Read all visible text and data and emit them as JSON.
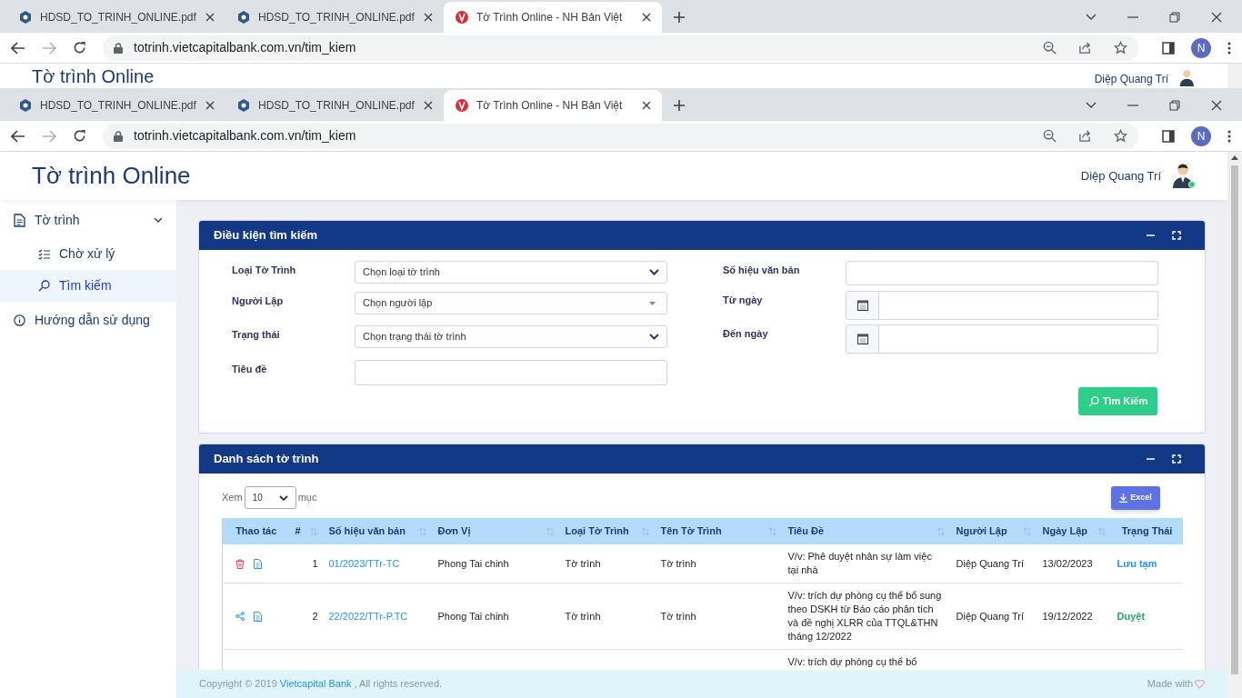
{
  "back_window": {
    "tabs": [
      {
        "kind": "pdf",
        "title": "HDSD_TO_TRINH_ONLINE.pdf",
        "selected": false
      },
      {
        "kind": "pdf",
        "title": "HDSD_TO_TRINH_ONLINE.pdf",
        "selected": false
      },
      {
        "kind": "site",
        "title": "Tờ Trình Online - NH Bản Việt",
        "selected": true
      }
    ],
    "url": "totrinh.vietcapitalbank.com.vn/tim_kiem",
    "profile_initial": "N",
    "page_title": "Tờ trình Online",
    "user_name": "Diệp Quang Trí"
  },
  "window": {
    "tabs": [
      {
        "kind": "pdf",
        "title": "HDSD_TO_TRINH_ONLINE.pdf",
        "selected": false
      },
      {
        "kind": "pdf",
        "title": "HDSD_TO_TRINH_ONLINE.pdf",
        "selected": false
      },
      {
        "kind": "site",
        "title": "Tờ Trình Online - NH Bản Việt",
        "selected": true
      }
    ],
    "url": "totrinh.vietcapitalbank.com.vn/tim_kiem",
    "profile_initial": "N"
  },
  "header": {
    "title": "Tờ trình Online",
    "user_name": "Diệp Quang Trí"
  },
  "sidebar": {
    "items": [
      {
        "label": "Tờ trình",
        "kind": "doc",
        "selected": false,
        "expanded": true,
        "children": [
          {
            "label": "Chờ xử lý",
            "kind": "list",
            "selected": false
          },
          {
            "label": "Tìm kiếm",
            "kind": "search",
            "selected": true
          }
        ]
      },
      {
        "label": "Hướng dẫn sử dụng",
        "kind": "info",
        "selected": false
      }
    ]
  },
  "search_form": {
    "title": "Điều kiện tìm kiếm",
    "left_fields": [
      {
        "label": "Loại Tờ Trình",
        "kind": "select",
        "value": "Chọn loại tờ trình"
      },
      {
        "label": "Người Lập",
        "kind": "combo",
        "value": "Chọn người lập"
      },
      {
        "label": "Trạng thái",
        "kind": "select",
        "value": "Chọn trạng thái tờ trình"
      },
      {
        "label": "Tiêu đề",
        "kind": "text"
      }
    ],
    "right_fields": [
      {
        "label": "Số hiệu văn bản",
        "kind": "text"
      },
      {
        "label": "Từ ngày",
        "kind": "date"
      },
      {
        "label": "Đến ngày",
        "kind": "date"
      }
    ],
    "button": "Tìm Kiếm"
  },
  "list": {
    "title": "Danh sách tờ trình",
    "show_label": "Xem",
    "page_size": "10",
    "entries_label": "mục",
    "excel_button": "Excel",
    "columns": [
      {
        "label": "Thao tác",
        "sortable": false
      },
      {
        "label": "#",
        "sortable": true
      },
      {
        "label": "Số hiệu văn bản",
        "sortable": true
      },
      {
        "label": "Đơn Vị",
        "sortable": true
      },
      {
        "label": "Loại Tờ Trình",
        "sortable": true
      },
      {
        "label": "Tên Tờ Trình",
        "sortable": true
      },
      {
        "label": "Tiêu Đề",
        "sortable": true
      },
      {
        "label": "Người Lập",
        "sortable": true
      },
      {
        "label": "Ngày Lập",
        "sortable": true
      },
      {
        "label": "Trạng Thái",
        "sortable": false
      }
    ],
    "rows": [
      {
        "actions": [
          {
            "kind": "delete"
          },
          {
            "kind": "view"
          }
        ],
        "number": "1",
        "doc_no": "01/2023/TTr-TC",
        "unit": "Phong Tai chinh",
        "type": "Tờ trình",
        "name": "Tờ trình",
        "title": "V/v: Phê duyệt nhân sự làm việc tại nhà",
        "creator": "Diệp Quang Trí",
        "date": "13/02/2023",
        "status": "Lưu tạm",
        "color": "#2196f3"
      },
      {
        "actions": [
          {
            "kind": "share"
          },
          {
            "kind": "view"
          }
        ],
        "number": "2",
        "doc_no": "22/2022/TTr-P.TC",
        "unit": "Phong Tai chinh",
        "type": "Tờ trình",
        "name": "Tờ trình",
        "title": "V/v: trích dự phòng cụ thể bổ sung theo DSKH từ Báo cáo phân tích và đề nghị XLRR của TTQL&THN tháng 12/2022",
        "creator": "Diệp Quang Trí",
        "date": "19/12/2022",
        "status": "Duyệt",
        "color": "#27a86a"
      },
      {
        "title": "V/v: trích dự phòng cụ thể bổ"
      }
    ]
  },
  "footer": {
    "copyright": "Copyright © 2019",
    "link": "Vietcapital Bank",
    "rights": ", All rights reserved.",
    "made_with": "Made with"
  }
}
